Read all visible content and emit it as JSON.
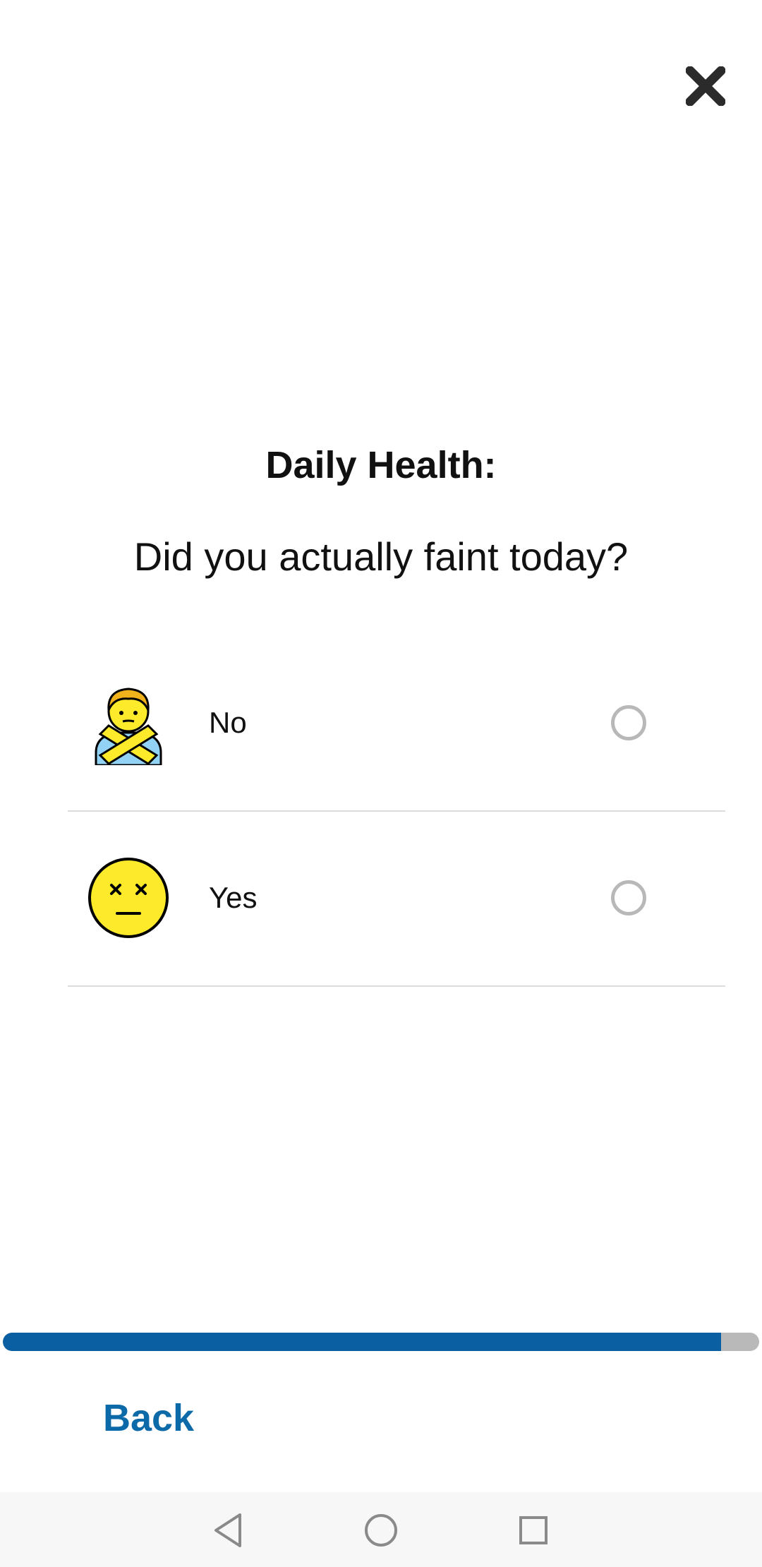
{
  "header": {
    "close_icon": "close-x-icon"
  },
  "survey": {
    "title": "Daily Health:",
    "question": "Did you actually faint today?",
    "options": [
      {
        "label": "No",
        "icon": "person-gesturing-no-icon",
        "selected": false
      },
      {
        "label": "Yes",
        "icon": "dizzy-face-icon",
        "selected": false
      }
    ]
  },
  "progress": {
    "fraction": 0.95
  },
  "footer": {
    "back_label": "Back"
  },
  "navbar": {
    "back_icon": "nav-back-icon",
    "home_icon": "nav-home-icon",
    "recents_icon": "nav-recents-icon"
  },
  "colors": {
    "accent": "#0a5fa2",
    "link": "#0d6aa8",
    "track": "#b9b9b9",
    "radio_border": "#b8b8b8",
    "divider": "#dcdcdc"
  }
}
